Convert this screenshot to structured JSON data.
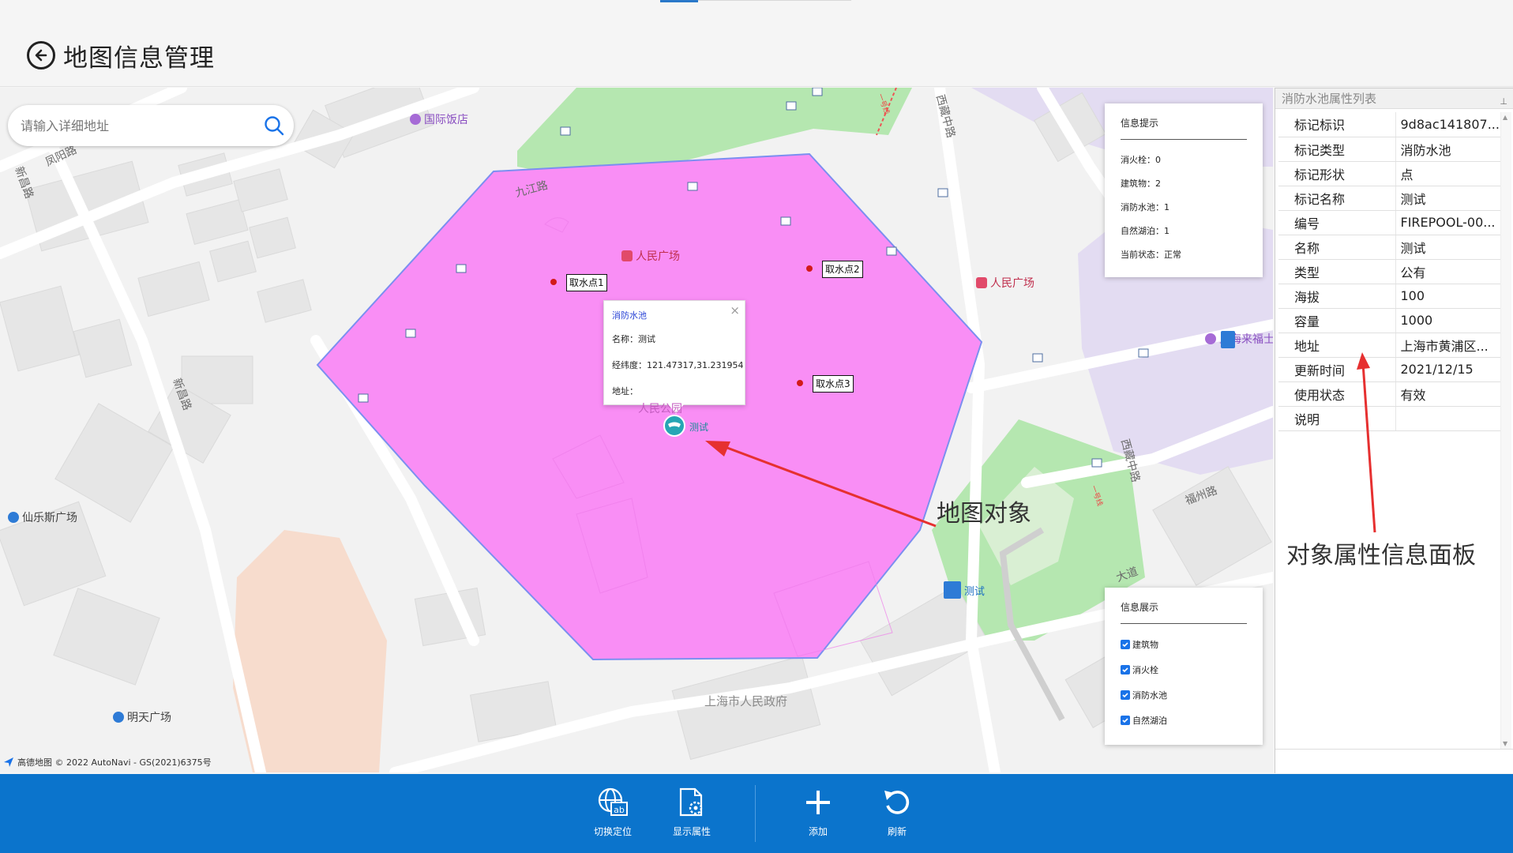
{
  "header": {
    "title": "地图信息管理"
  },
  "search": {
    "placeholder": "请输入详细地址"
  },
  "map": {
    "street_labels": [
      "九江路",
      "凤阳路",
      "新昌路",
      "新昌路",
      "西藏中路",
      "西藏中路",
      "福州路",
      "上海市人民政府",
      "一号线",
      "一号线",
      "大道"
    ],
    "pois": [
      {
        "label": "国际饭店",
        "color": "#a66bd6"
      },
      {
        "label": "人民广场",
        "color": "#e14a6a"
      },
      {
        "label": "人民广场",
        "color": "#e14a6a"
      },
      {
        "label": "仙乐斯广场",
        "color": "#2e7bd6"
      },
      {
        "label": "明天广场",
        "color": "#2e7bd6"
      },
      {
        "label": "上海来福士",
        "color": "#a66bd6"
      },
      {
        "label": "测试",
        "color": "#2e7bd6"
      }
    ],
    "sample_points": [
      "取水点1",
      "取水点2",
      "取水点3"
    ],
    "marker_label": "测试",
    "faded_label": "人民公园",
    "popup": {
      "title": "消防水池",
      "name": "名称：测试",
      "coords": "经纬度：121.47317,31.231954",
      "address": "地址："
    },
    "info_card": {
      "title": "信息提示",
      "rows": [
        "消火栓：0",
        "建筑物：2",
        "消防水池：1",
        "自然湖泊：1",
        "当前状态：正常"
      ]
    },
    "display_card": {
      "title": "信息展示",
      "options": [
        {
          "label": "建筑物",
          "checked": true
        },
        {
          "label": "消火栓",
          "checked": true
        },
        {
          "label": "消防水池",
          "checked": true
        },
        {
          "label": "自然湖泊",
          "checked": true
        }
      ]
    },
    "annotation": "地图对象",
    "copyright": "高德地图 © 2022 AutoNavi - GS(2021)6375号",
    "polygon_color": "#f98ef5",
    "polygon_stroke": "#7b8ff0"
  },
  "panel": {
    "title": "消防水池属性列表",
    "rows": [
      {
        "key": "标记标识",
        "value": "9d8ac141807..."
      },
      {
        "key": "标记类型",
        "value": "消防水池"
      },
      {
        "key": "标记形状",
        "value": "点"
      },
      {
        "key": "标记名称",
        "value": "测试"
      },
      {
        "key": "编号",
        "value": "FIREPOOL-00..."
      },
      {
        "key": "名称",
        "value": "测试"
      },
      {
        "key": "类型",
        "value": "公有"
      },
      {
        "key": "海拔",
        "value": "100"
      },
      {
        "key": "容量",
        "value": "1000"
      },
      {
        "key": "地址",
        "value": "上海市黄浦区..."
      },
      {
        "key": "更新时间",
        "value": "2021/12/15"
      },
      {
        "key": "使用状态",
        "value": "有效"
      },
      {
        "key": "说明",
        "value": ""
      }
    ],
    "annotation": "对象属性信息面板"
  },
  "toolbar": {
    "items": [
      {
        "label": "切换定位",
        "icon": "globe-ab-icon"
      },
      {
        "label": "显示属性",
        "icon": "doc-gear-icon"
      },
      {
        "label": "添加",
        "icon": "plus-icon"
      },
      {
        "label": "刷新",
        "icon": "refresh-icon"
      }
    ],
    "color": "#0b74cc"
  }
}
